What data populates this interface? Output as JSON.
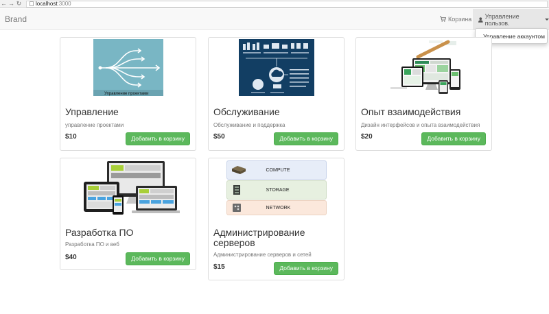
{
  "browser": {
    "url_host": "localhost",
    "url_port": ":3000"
  },
  "navbar": {
    "brand": "Brand",
    "cart_label": "Корзина",
    "user_menu_label": "Управление пользов.",
    "dropdown_items": [
      "Управление аккаунтом"
    ]
  },
  "products": [
    {
      "title": "Управление",
      "description": "управление проектами",
      "price": "$10",
      "button": "Добавить в корзину",
      "image_caption": "Управление проектами"
    },
    {
      "title": "Обслуживание",
      "description": "Обслуживание и поддержка",
      "price": "$50",
      "button": "Добавить в корзину"
    },
    {
      "title": "Опыт взаимодействия",
      "description": "Дизайн интерфейсов и опыта взаимодействия",
      "price": "$20",
      "button": "Добавить в корзину"
    },
    {
      "title": "Разработка ПО",
      "description": "Разработка ПО и веб",
      "price": "$40",
      "button": "Добавить в корзину"
    },
    {
      "title": "Администрирование серверов",
      "description": "Администрирование серверов и сетей",
      "price": "$15",
      "button": "Добавить в корзину",
      "image_labels": [
        "COMPUTE",
        "STORAGE",
        "NETWORK"
      ]
    }
  ],
  "colors": {
    "button_green": "#5cb85c",
    "navbar_bg": "#f8f8f8",
    "navy": "#123e63",
    "teal": "#79b6c4"
  }
}
